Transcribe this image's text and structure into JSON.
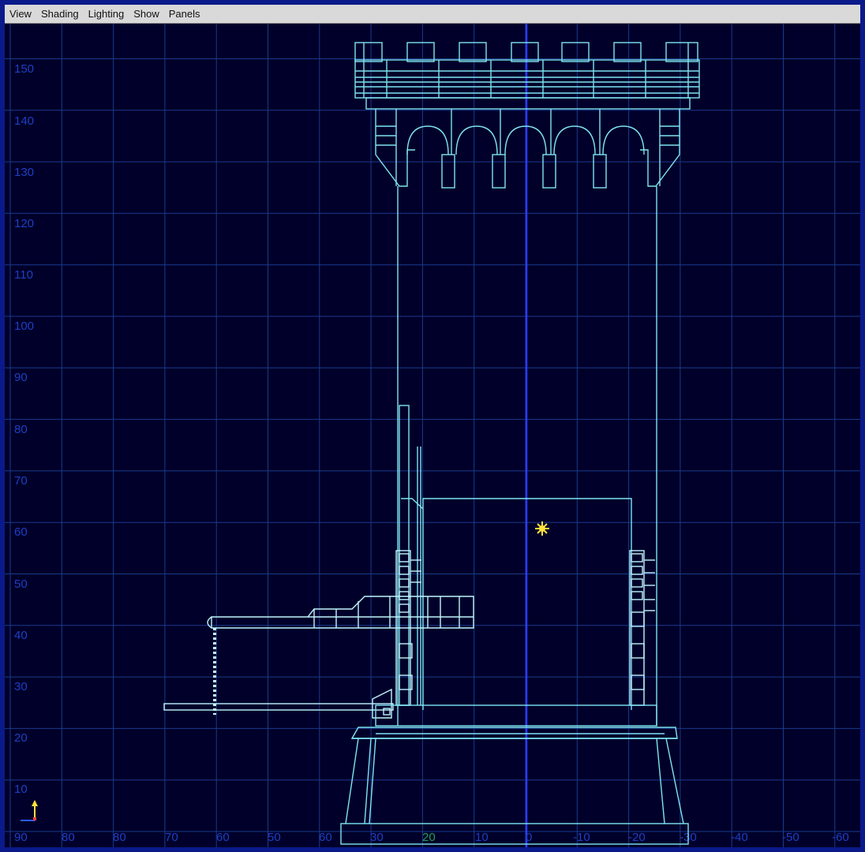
{
  "menubar": {
    "items": [
      "View",
      "Shading",
      "Lighting",
      "Show",
      "Panels"
    ]
  },
  "viewport": {
    "view": "front orthographic wireframe",
    "y_ticks": [
      "150",
      "140",
      "130",
      "120",
      "110",
      "100",
      "90",
      "80",
      "70",
      "60",
      "50",
      "40",
      "30",
      "20",
      "10"
    ],
    "x_ticks": [
      "90",
      "80",
      "80",
      "70",
      "60",
      "50",
      "60",
      "30",
      "20",
      "10",
      "0",
      "-10",
      "-20",
      "-30",
      "-40",
      "-50",
      "-60"
    ],
    "x_tick_highlight_index": 8
  },
  "colors": {
    "frame": "#0a1a8a",
    "menubar": "#d9d9d9",
    "viewport_bg": "#00002a",
    "grid": "#1a3a8c",
    "origin_axis": "#2a3cff",
    "wire": "#7fe4f2",
    "wire_selected": "#bff6ff",
    "light": "#ffe23a",
    "axis_label": "#1f3fc4",
    "origin_label": "#1fa04a"
  },
  "icons": {
    "light": "point-light-icon",
    "axis_gizmo": "axis-gizmo-icon"
  }
}
